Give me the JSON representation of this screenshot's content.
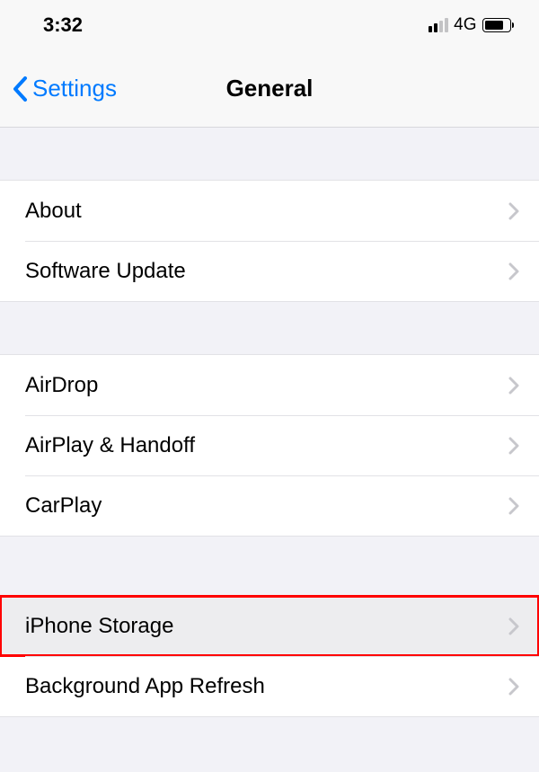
{
  "status_bar": {
    "time": "3:32",
    "network_type": "4G",
    "battery_pct": 78
  },
  "nav": {
    "back_label": "Settings",
    "title": "General"
  },
  "groups": [
    {
      "items": [
        {
          "label": "About"
        },
        {
          "label": "Software Update"
        }
      ]
    },
    {
      "items": [
        {
          "label": "AirDrop"
        },
        {
          "label": "AirPlay & Handoff"
        },
        {
          "label": "CarPlay"
        }
      ]
    },
    {
      "items": [
        {
          "label": "iPhone Storage",
          "highlighted": true
        },
        {
          "label": "Background App Refresh"
        }
      ]
    }
  ]
}
